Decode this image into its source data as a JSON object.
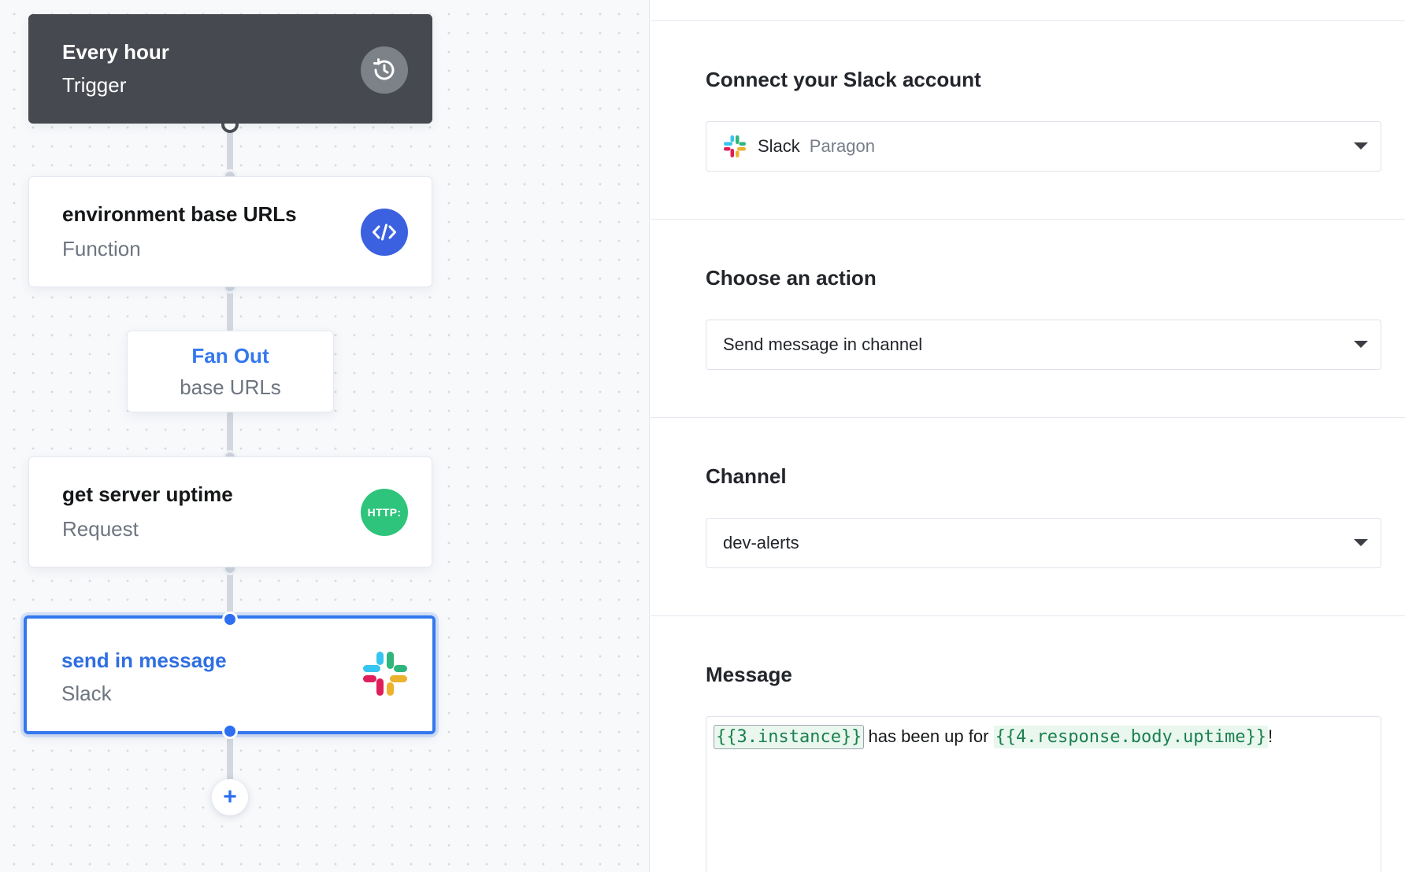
{
  "workflow": {
    "steps": [
      {
        "title": "Every hour",
        "subtitle": "Trigger",
        "icon": "clock-icon"
      },
      {
        "title": "environment base URLs",
        "subtitle": "Function",
        "icon": "code-icon"
      },
      {
        "title": "get server uptime",
        "subtitle": "Request",
        "icon": "http-icon",
        "icon_text": "HTTP:"
      },
      {
        "title": "send in message",
        "subtitle": "Slack",
        "icon": "slack-icon"
      }
    ],
    "fanout": {
      "title": "Fan Out",
      "subtitle": "base URLs"
    },
    "add_label": "+"
  },
  "panel": {
    "account": {
      "label": "Connect your Slack account",
      "app_name": "Slack",
      "workspace": "Paragon"
    },
    "action": {
      "label": "Choose an action",
      "value": "Send message in channel"
    },
    "channel": {
      "label": "Channel",
      "value": "dev-alerts"
    },
    "message": {
      "label": "Message",
      "token_1": "{{3.instance}}",
      "text_1": " has been up for ",
      "token_2": "{{4.response.body.uptime}}",
      "text_2": "!"
    }
  },
  "colors": {
    "accent": "#3478ee",
    "trigger_bg": "#46494f",
    "function_icon": "#3b61e0",
    "http_icon": "#2ec47b",
    "token_bg": "#e9f7ee",
    "token_text": "#1b7f4e"
  }
}
